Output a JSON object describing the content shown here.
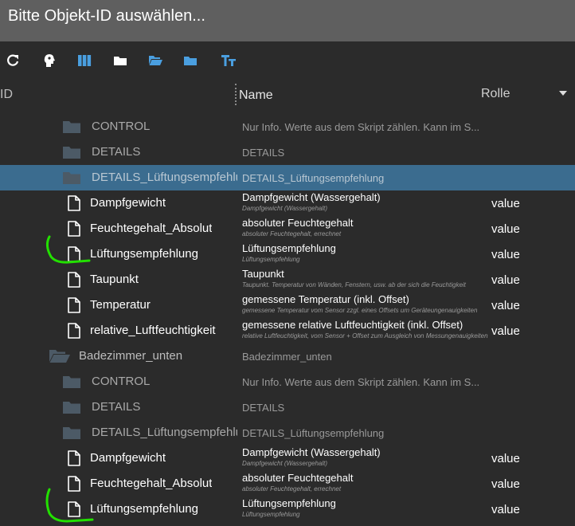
{
  "dialog": {
    "title": "Bitte Objekt-ID auswählen..."
  },
  "toolbar": {
    "icons": [
      "refresh-icon",
      "person-icon",
      "columns-icon",
      "folder-icon",
      "folder-open-icon",
      "folder-blue-icon",
      "text-size-icon"
    ],
    "accent": "#4a9fe0"
  },
  "columns": {
    "id": "ID",
    "name": "Name",
    "role": "Rolle"
  },
  "rows": [
    {
      "type": "folder",
      "label": "CONTROL",
      "name": "Nur Info. Werte aus dem Skript zählen. Kann im S..."
    },
    {
      "type": "folder",
      "label": "DETAILS",
      "name": "DETAILS"
    },
    {
      "type": "folder",
      "label": "DETAILS_Lüftungsempfehlung",
      "name": "DETAILS_Lüftungsempfehlung",
      "selected": true
    },
    {
      "type": "state",
      "label": "Dampfgewicht",
      "name": "Dampfgewicht (Wassergehalt)",
      "sub": "Dampfgewicht (Wassergehalt)",
      "role": "value"
    },
    {
      "type": "state",
      "label": "Feuchtegehalt_Absolut",
      "name": "absoluter Feuchtegehalt",
      "sub": "absoluter Feuchtegehalt, errechnet",
      "role": "value"
    },
    {
      "type": "state",
      "label": "Lüftungsempfehlung",
      "name": "Lüftungsempfehlung",
      "sub": "Lüftungsempfehlung",
      "role": "value"
    },
    {
      "type": "state",
      "label": "Taupunkt",
      "name": "Taupunkt",
      "sub": "Taupunkt. Temperatur von Wänden, Fenstern, usw. ab der sich die Feuchtigkeit",
      "role": "value"
    },
    {
      "type": "state",
      "label": "Temperatur",
      "name": "gemessene Temperatur (inkl. Offset)",
      "sub": "gemessene Temperatur vom Sensor zzgl. eines Offsets um Geräteungenauigkeiten",
      "role": "value"
    },
    {
      "type": "state",
      "label": "relative_Luftfeuchtigkeit",
      "name": "gemessene relative Luftfeuchtigkeit (inkl. Offset)",
      "sub": "relative Luftfeuchtigkeit, vom Sensor + Offset zum Ausgleich von Messungenauigkeiten",
      "role": "value"
    },
    {
      "type": "openfolder",
      "label": "Badezimmer_unten",
      "name": "Badezimmer_unten"
    },
    {
      "type": "folder",
      "label": "CONTROL",
      "name": "Nur Info. Werte aus dem Skript zählen. Kann im S..."
    },
    {
      "type": "folder",
      "label": "DETAILS",
      "name": "DETAILS"
    },
    {
      "type": "folder",
      "label": "DETAILS_Lüftungsempfehlung",
      "name": "DETAILS_Lüftungsempfehlung"
    },
    {
      "type": "state",
      "label": "Dampfgewicht",
      "name": "Dampfgewicht (Wassergehalt)",
      "sub": "Dampfgewicht (Wassergehalt)",
      "role": "value"
    },
    {
      "type": "state",
      "label": "Feuchtegehalt_Absolut",
      "name": "absoluter Feuchtegehalt",
      "sub": "absoluter Feuchtegehalt, errechnet",
      "role": "value"
    },
    {
      "type": "state",
      "label": "Lüftungsempfehlung",
      "name": "Lüftungsempfehlung",
      "sub": "Lüftungsempfehlung",
      "role": "value"
    }
  ],
  "colors": {
    "titlebar": "#5f5f5f",
    "background": "#2b2b2b",
    "selected_row": "#3b6c8f",
    "folder_icon": "#4c5a66",
    "annotation": "#22e000"
  },
  "annotations": [
    "green-check-mark",
    "green-check-mark"
  ]
}
